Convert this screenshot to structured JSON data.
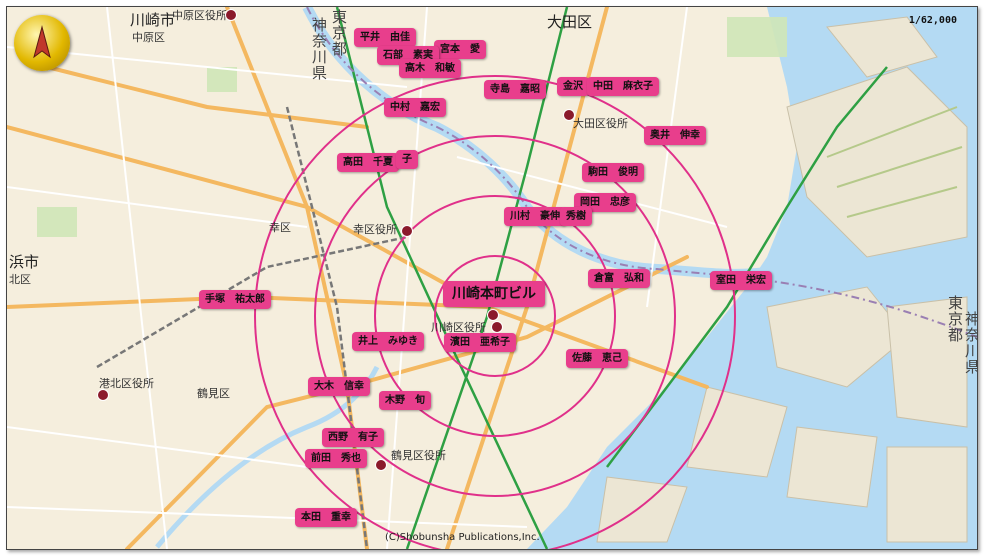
{
  "map": {
    "scale": "1/62,000",
    "copyright": "(C)Shobunsha Publications,Inc.",
    "center_label": "川崎本町ビル",
    "colors": {
      "land": "#f5eedd",
      "water": "#b4daf3",
      "ring": "#e0308a",
      "tag": "#e83e8c",
      "rail": "#2ea043",
      "road": "#f4b860",
      "marker": "#8b1a2b"
    },
    "place_labels": [
      {
        "id": "kawasaki-shi",
        "text": "川崎市"
      },
      {
        "id": "nakahara-ku",
        "text": "中原区"
      },
      {
        "id": "nakahara-office",
        "text": "中原区役所"
      },
      {
        "id": "ota-ku",
        "text": "大田区"
      },
      {
        "id": "ota-office",
        "text": "大田区役所"
      },
      {
        "id": "saiwai-ku",
        "text": "幸区"
      },
      {
        "id": "saiwai-office",
        "text": "幸区役所"
      },
      {
        "id": "kawasaki-office",
        "text": "川崎区役所"
      },
      {
        "id": "hamashi",
        "text": "浜市"
      },
      {
        "id": "kita-ku",
        "text": "北区"
      },
      {
        "id": "kohoku-office",
        "text": "港北区役所"
      },
      {
        "id": "tsurumi-ku",
        "text": "鶴見区"
      },
      {
        "id": "tsurumi-office",
        "text": "鶴見区役所"
      },
      {
        "id": "kanagawa-border",
        "text": "神奈川県"
      },
      {
        "id": "tokyo-border",
        "text": "東京都"
      },
      {
        "id": "tokyo-east",
        "text": "東京都"
      },
      {
        "id": "kanagawa-east",
        "text": "神奈川県"
      }
    ],
    "people": [
      "平井　由佳",
      "宮本　愛",
      "石部　素実",
      "高木　和敏",
      "寺島　嘉昭",
      "金沢",
      "中田　麻衣子",
      "中村　嘉宏",
      "奥井　伸幸",
      "高田　千夏",
      "子",
      "駒田　俊明",
      "岡田　忠彦",
      "川村　豪伸",
      "秀樹",
      "倉富　弘和",
      "室田　栄宏",
      "手塚　祐太郎",
      "井上　みゆき",
      "濱田　亜希子",
      "佐藤　恵己",
      "大木　信幸",
      "木野　旬",
      "西野　有子",
      "前田　秀也",
      "本田　重幸"
    ]
  }
}
